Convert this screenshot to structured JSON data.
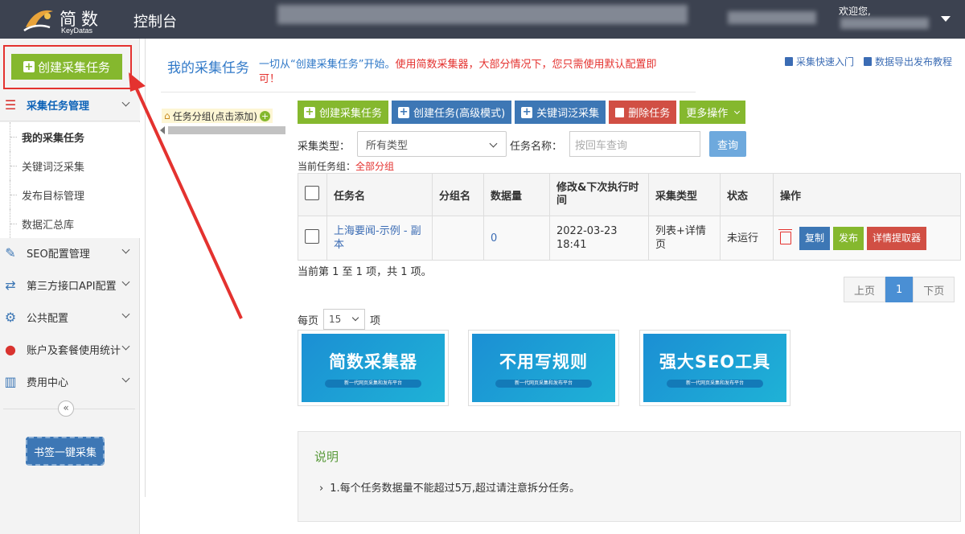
{
  "header": {
    "logo_text": "简数",
    "logo_sub": "KeyDatas",
    "title": "控制台",
    "welcome": "欢迎您,"
  },
  "sidebar": {
    "create_button": "创建采集任务",
    "sections": [
      {
        "label": "采集任务管理",
        "icon": "list-icon",
        "active": true
      },
      {
        "label": "SEO配置管理",
        "icon": "edit-icon"
      },
      {
        "label": "第三方接口API配置",
        "icon": "exchange-icon"
      },
      {
        "label": "公共配置",
        "icon": "gear-icon"
      },
      {
        "label": "账户及套餐使用统计",
        "icon": "user-icon"
      },
      {
        "label": "费用中心",
        "icon": "bar-chart-icon"
      }
    ],
    "sub_items": [
      "我的采集任务",
      "关键词泛采集",
      "发布目标管理",
      "数据汇总库"
    ],
    "collapse_glyph": "«",
    "bookmark_button": "书签一键采集"
  },
  "main": {
    "title": "我的采集任务",
    "description_prefix": "一切从“创建采集任务”开始。",
    "description_rest": "使用简数采集器，大部分情况下，您只需使用默认配置即可！",
    "links": [
      "采集快速入门",
      "数据导出发布教程"
    ],
    "group_label": "任务分组(点击添加)",
    "toolbar": {
      "create": "创建采集任务",
      "create_advanced": "创建任务(高级模式)",
      "keyword": "关键词泛采集",
      "delete": "删除任务",
      "more": "更多操作"
    },
    "filter": {
      "type_label": "采集类型：",
      "type_value": "所有类型",
      "name_label": "任务名称：",
      "name_placeholder": "按回车查询",
      "query": "查询"
    },
    "current_group_label": "当前任务组：",
    "current_group_value": "全部分组",
    "table": {
      "headers": [
        "任务名",
        "分组名",
        "数据量",
        "修改&下次执行时间",
        "采集类型",
        "状态",
        "操作"
      ],
      "row": {
        "name": "上海要闻-示例 - 副本",
        "group": "",
        "count": "0",
        "time": "2022-03-23 18:41",
        "type": "列表+详情页",
        "status": "未运行",
        "copy": "复制",
        "publish": "发布",
        "extract": "详情提取器"
      }
    },
    "page_info": "当前第 1 至 1 项，共 1 项。",
    "pager": {
      "prev": "上页",
      "current": "1",
      "next": "下页"
    },
    "per_page_label": "每页",
    "per_page_value": "15",
    "per_page_suffix": "项",
    "banners": [
      {
        "title": "简数采集器",
        "sub": "新一代网页采集和发布平台"
      },
      {
        "title": "不用写规则",
        "sub": "新一代网页采集和发布平台"
      },
      {
        "title": "强大SEO工具",
        "sub": "新一代网页采集和发布平台"
      }
    ],
    "note": {
      "title": "说明",
      "item": "1.每个任务数据量不能超过5万,超过请注意拆分任务。"
    }
  },
  "colors": {
    "topbar": "#3c4250",
    "green": "#85b82e",
    "blue": "#3d77b5",
    "red": "#d14f44",
    "annotation": "#e4322f"
  }
}
